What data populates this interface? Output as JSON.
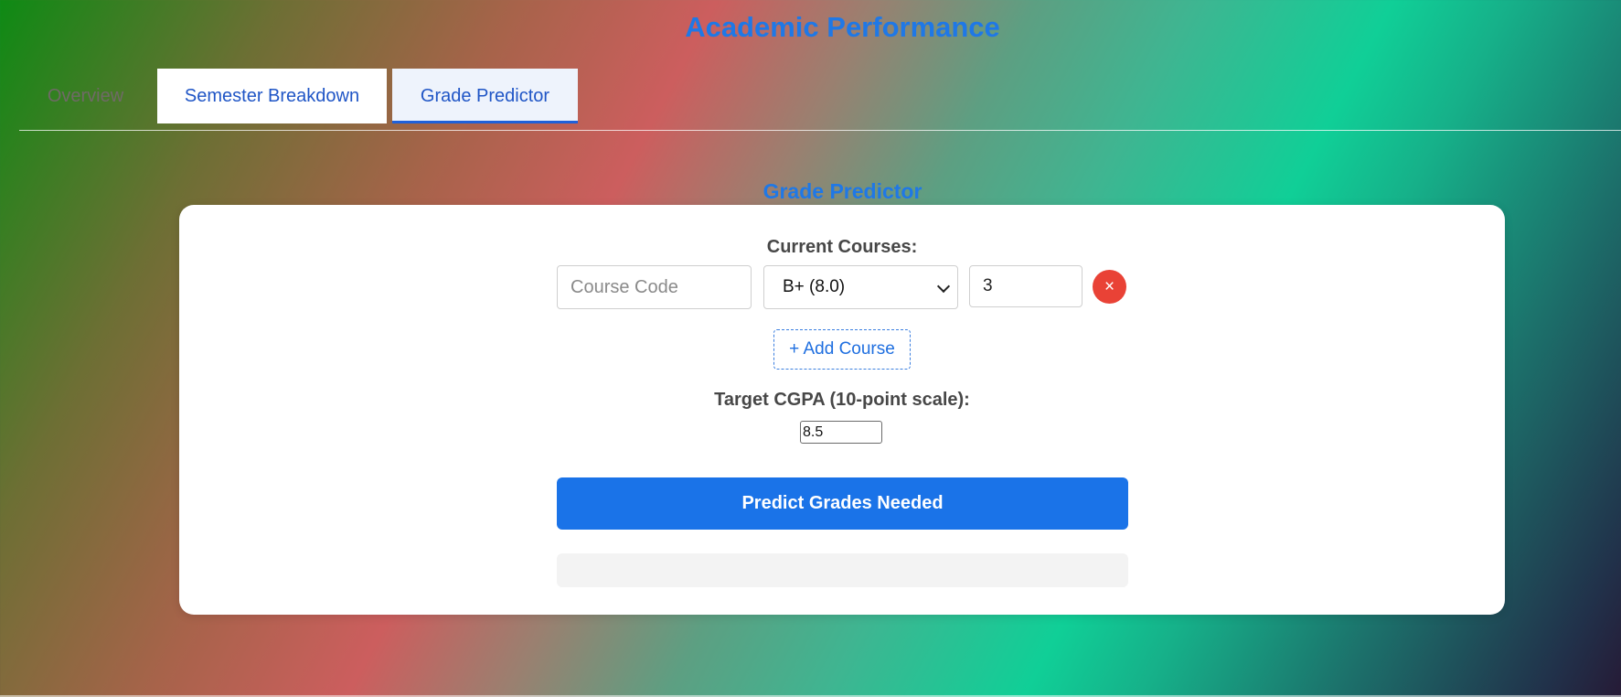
{
  "header": {
    "title": "Academic Performance"
  },
  "tabs": [
    {
      "label": "Overview",
      "active": false
    },
    {
      "label": "Semester Breakdown",
      "active": false
    },
    {
      "label": "Grade Predictor",
      "active": true
    }
  ],
  "predictor": {
    "heading": "Grade Predictor",
    "current_courses_label": "Current Courses:",
    "course_row": {
      "course_code_placeholder": "Course Code",
      "course_code_value": "",
      "grade_selected": "B+ (8.0)",
      "credits_value": "3",
      "remove_label": "×"
    },
    "add_course_label": "+ Add Course",
    "target_label": "Target CGPA (10-point scale):",
    "target_value": "8.5",
    "predict_button_label": "Predict Grades Needed",
    "result_text": ""
  },
  "colors": {
    "accent": "#1a73e8",
    "title": "#1f78e6",
    "remove": "#e94236"
  },
  "icons": {
    "remove": "close-icon",
    "select": "chevron-down-icon"
  }
}
